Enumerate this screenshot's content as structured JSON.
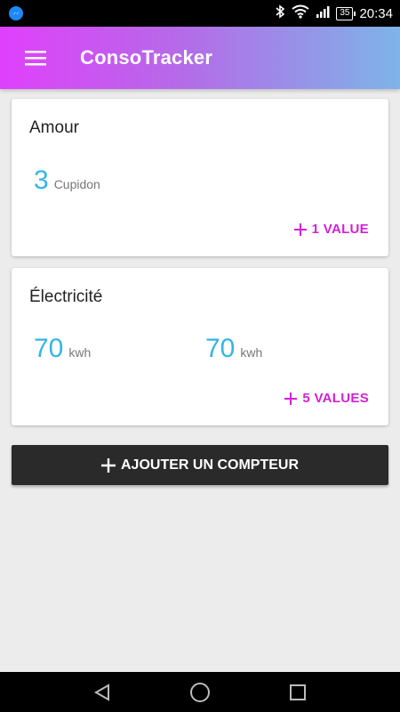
{
  "status_bar": {
    "battery": "35",
    "time": "20:34",
    "icons": [
      "messenger-icon",
      "bluetooth-icon",
      "wifi-icon",
      "signal-icon",
      "battery-icon"
    ]
  },
  "app_bar": {
    "title": "ConsoTracker",
    "menu_icon": "hamburger-menu-icon",
    "gradient": [
      "#e040fb",
      "#7eb4e8"
    ]
  },
  "counters": [
    {
      "title": "Amour",
      "values": [
        {
          "value": "3",
          "unit": "Cupidon"
        }
      ],
      "add_label": "1 VALUE"
    },
    {
      "title": "Électricité",
      "values": [
        {
          "value": "70",
          "unit": "kwh"
        },
        {
          "value": "70",
          "unit": "kwh"
        }
      ],
      "add_label": "5 VALUES"
    }
  ],
  "add_counter_button": {
    "label": "AJOUTER UN COMPTEUR"
  },
  "colors": {
    "accent": "#d321d6",
    "value": "#33b5e5",
    "button_dark": "#2a2a2a",
    "background": "#ececec"
  },
  "nav_bar": {
    "icons": [
      "back-icon",
      "home-icon",
      "recents-icon"
    ]
  }
}
